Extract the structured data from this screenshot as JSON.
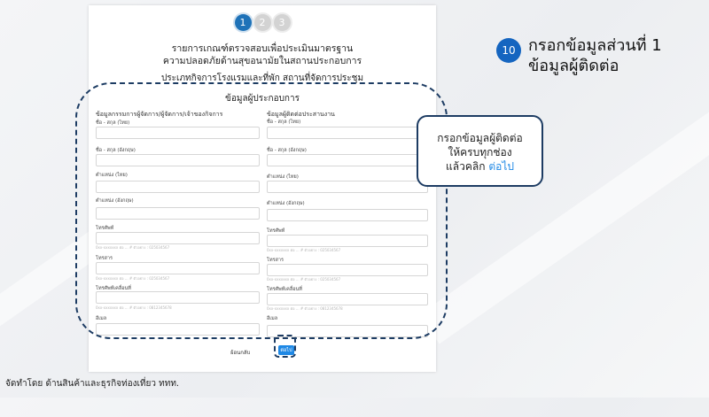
{
  "form": {
    "steps": [
      "1",
      "2",
      "3"
    ],
    "heading_line1": "รายการเกณฑ์ตรวจสอบเพื่อประเมินมาตรฐาน",
    "heading_line2": "ความปลอดภัยด้านสุขอนามัยในสถานประกอบการ",
    "category": "ประเภทกิจการโรงแรมและที่พัก  สถานที่จัดการประชุม",
    "section_title": "ข้อมูลผู้ประกอบการ",
    "left_column_title": "ข้อมูลกรรมการผู้จัดการ/ผู้จัดการ/เจ้าของกิจการ",
    "right_column_title": "ข้อมูลผู้ติดต่อประสานงาน",
    "fields": {
      "name_th": "ชื่อ - สกุล (ไทย)",
      "name_en": "ชื่อ - สกุล (อังกฤษ)",
      "position_th": "ตำแหน่ง (ไทย)",
      "position_en": "ตำแหน่ง (อังกฤษ)",
      "phone": "โทรศัพท์",
      "fax": "โทรสาร",
      "mobile": "โทรศัพท์เคลื่อนที่",
      "email": "อีเมล"
    },
    "hints": {
      "phone": "0xx-xxxxxxx ต่อ ... # ตัวอย่าง : 025034567",
      "fax": "0xx-xxxxxxx ต่อ ... # ตัวอย่าง : 025034567",
      "mobile": "0xx-xxxxxxx ต่อ ... # ตัวอย่าง : 0812345678"
    },
    "back_label": "ย้อนกลับ",
    "next_label": "ต่อไป"
  },
  "instruction": {
    "step_number": "10",
    "title_line1": "กรอกข้อมูลส่วนที่ 1",
    "title_line2": "ข้อมูลผู้ติดต่อ",
    "callout_line1": "กรอกข้อมูลผู้ติดต่อ",
    "callout_line2": "ให้ครบทุกช่อง",
    "callout_line3_prefix": "แล้วคลิก ",
    "callout_link": "ต่อไป"
  },
  "footer": {
    "credit": "จัดทำโดย ด้านสินค้าและธุรกิจท่องเที่ยว ททท."
  },
  "colors": {
    "accent": "#1e72b8",
    "button": "#1e88e5",
    "dashed_outline": "#1d3c63"
  }
}
